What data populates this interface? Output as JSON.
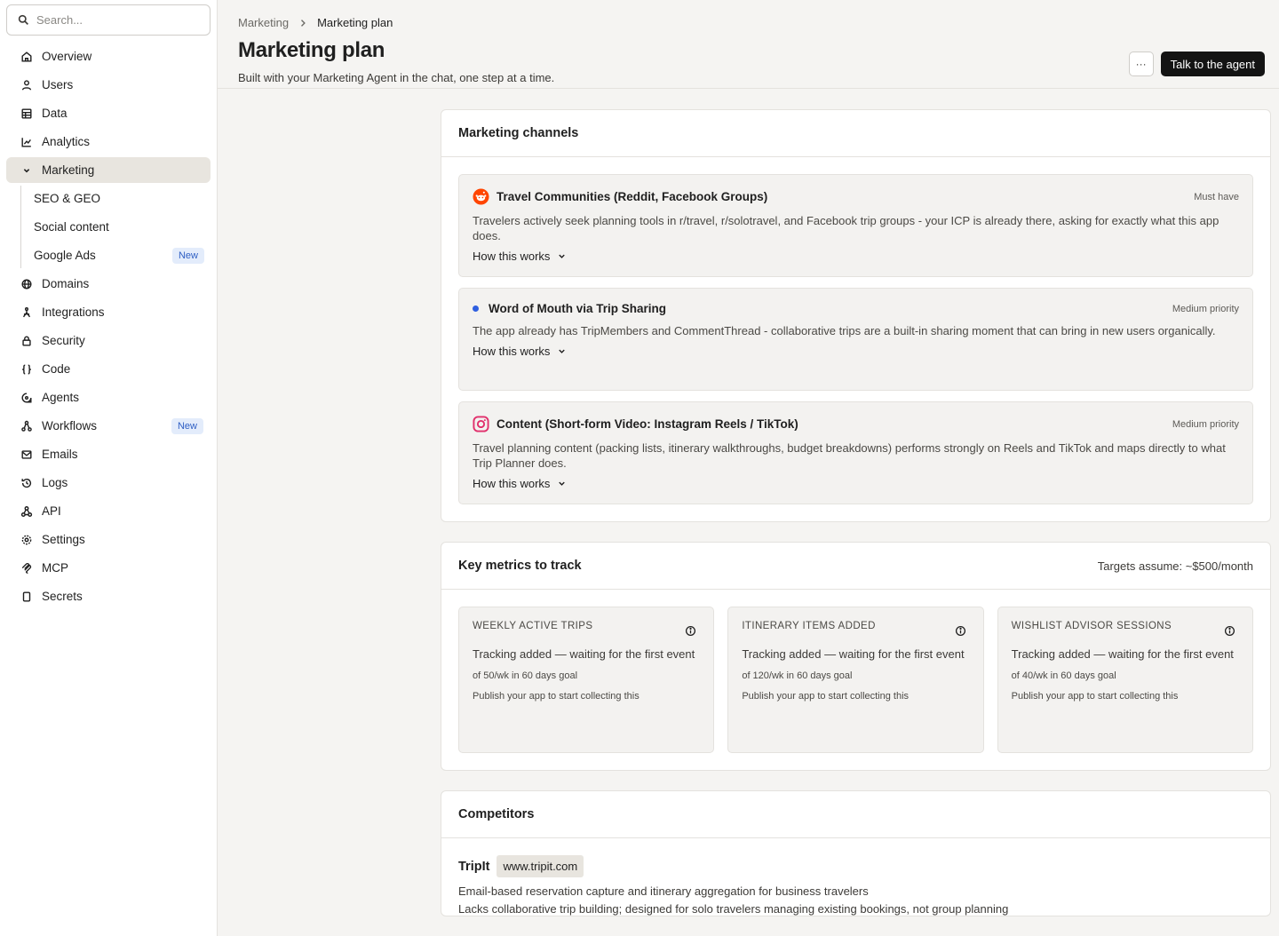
{
  "search": {
    "placeholder": "Search..."
  },
  "sidebar": {
    "items": [
      {
        "label": "Overview"
      },
      {
        "label": "Users"
      },
      {
        "label": "Data"
      },
      {
        "label": "Analytics"
      },
      {
        "label": "Marketing"
      },
      {
        "label": "Domains"
      },
      {
        "label": "Integrations"
      },
      {
        "label": "Security"
      },
      {
        "label": "Code"
      },
      {
        "label": "Agents"
      },
      {
        "label": "Workflows",
        "badge": "New"
      },
      {
        "label": "Emails"
      },
      {
        "label": "Logs"
      },
      {
        "label": "API"
      },
      {
        "label": "Settings"
      },
      {
        "label": "MCP"
      },
      {
        "label": "Secrets"
      }
    ],
    "marketing_sub": [
      {
        "label": "SEO & GEO"
      },
      {
        "label": "Social content"
      },
      {
        "label": "Google Ads",
        "badge": "New"
      }
    ]
  },
  "header": {
    "breadcrumb": [
      "Marketing",
      "Marketing plan"
    ],
    "title": "Marketing plan",
    "subtitle": "Built with your Marketing Agent in the chat, one step at a time.",
    "more_label": "···",
    "agent_button": "Talk to the agent"
  },
  "channels": {
    "title": "Marketing channels",
    "items": [
      {
        "name": "Travel Communities (Reddit, Facebook Groups)",
        "icon": "reddit-icon",
        "priority": "Must have",
        "desc": "Travelers actively seek planning tools in r/travel, r/solotravel, and Facebook trip groups - your ICP is already there, asking for exactly what this app does.",
        "how": "How this works"
      },
      {
        "name": "Word of Mouth via Trip Sharing",
        "icon": "blue-dot-icon",
        "priority": "Medium priority",
        "desc": "The app already has TripMembers and CommentThread - collaborative trips are a built-in sharing moment that can bring in new users organically.",
        "how": "How this works"
      },
      {
        "name": "Content (Short-form Video: Instagram Reels / TikTok)",
        "icon": "instagram-icon",
        "priority": "Medium priority",
        "desc": "Travel planning content (packing lists, itinerary walkthroughs, budget breakdowns) performs strongly on Reels and TikTok and maps directly to what Trip Planner does.",
        "how": "How this works"
      }
    ]
  },
  "metrics": {
    "title": "Key metrics to track",
    "note": "Targets assume: ~$500/month",
    "items": [
      {
        "label": "WEEKLY ACTIVE TRIPS",
        "status": "Tracking added — waiting for the first event",
        "goal": "of 50/wk in 60 days goal",
        "hint": "Publish your app to start collecting this"
      },
      {
        "label": "ITINERARY ITEMS ADDED",
        "status": "Tracking added — waiting for the first event",
        "goal": "of 120/wk in 60 days goal",
        "hint": "Publish your app to start collecting this"
      },
      {
        "label": "WISHLIST ADVISOR SESSIONS",
        "status": "Tracking added — waiting for the first event",
        "goal": "of 40/wk in 60 days goal",
        "hint": "Publish your app to start collecting this"
      }
    ]
  },
  "competitors": {
    "title": "Competitors",
    "items": [
      {
        "name": "TripIt",
        "url": "www.tripit.com",
        "lines": [
          "Email-based reservation capture and itinerary aggregation for business travelers",
          "Lacks collaborative trip building; designed for solo travelers managing existing bookings, not group planning"
        ]
      }
    ]
  },
  "colors": {
    "accent": "#141414",
    "reddit": "#ff4500",
    "instagram": "#e1306c",
    "dot": "#2f5fe0",
    "badge": "#2f5fc4"
  }
}
